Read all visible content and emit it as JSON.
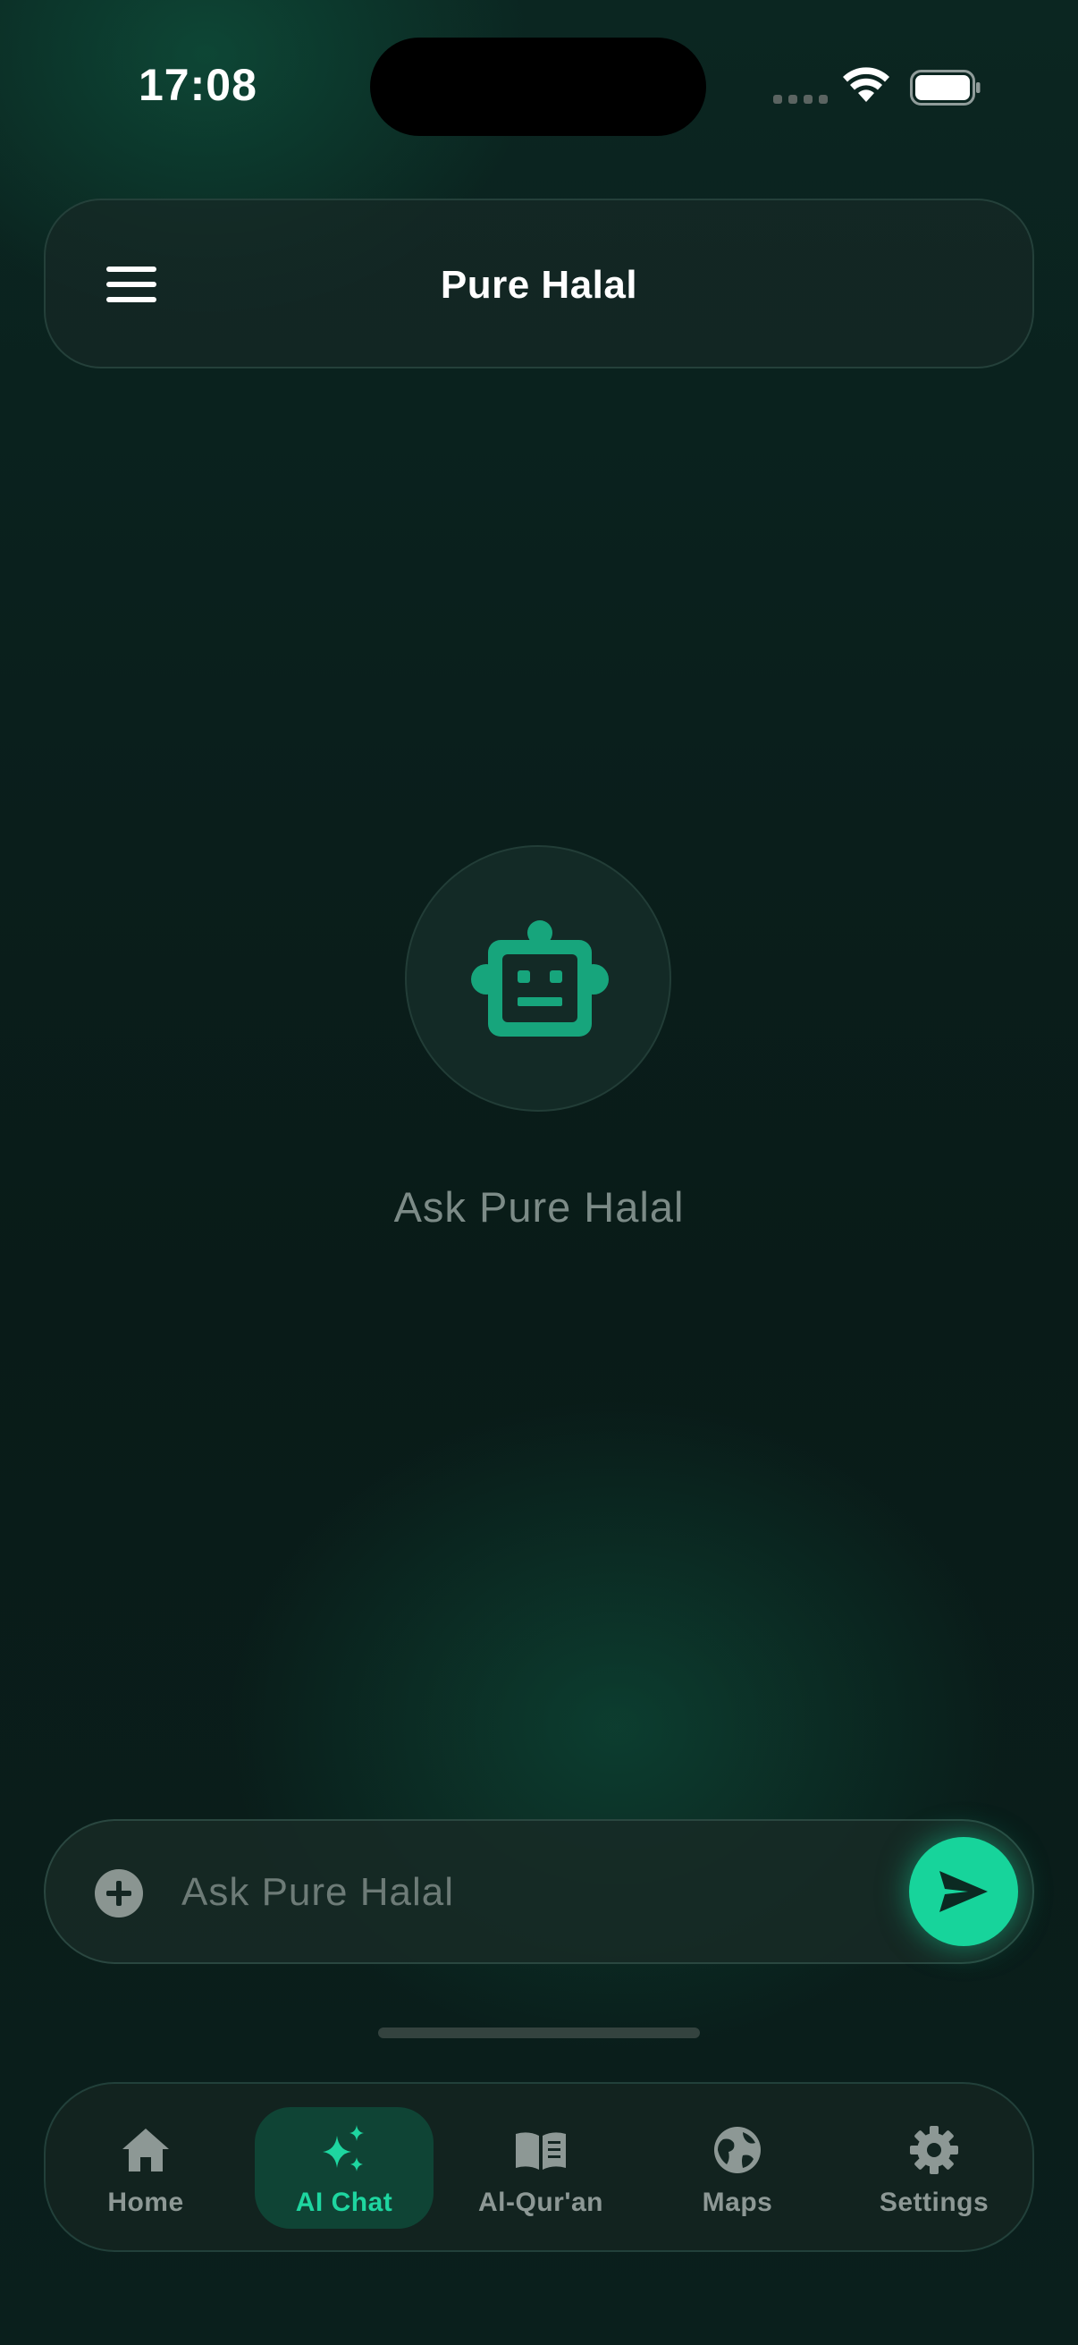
{
  "status_bar": {
    "time": "17:08"
  },
  "header": {
    "title": "Pure Halal",
    "menu_icon": "hamburger-menu-icon"
  },
  "empty_state": {
    "icon": "robot-icon",
    "prompt": "Ask Pure Halal"
  },
  "composer": {
    "placeholder": "Ask Pure Halal",
    "value": "",
    "add_icon": "plus-circle-icon",
    "send_icon": "send-icon"
  },
  "tab_bar": {
    "active": "AI Chat",
    "items": [
      {
        "label": "Home",
        "icon": "home-icon"
      },
      {
        "label": "AI Chat",
        "icon": "sparkles-icon"
      },
      {
        "label": "Al-Qur'an",
        "icon": "book-open-icon"
      },
      {
        "label": "Maps",
        "icon": "globe-icon"
      },
      {
        "label": "Settings",
        "icon": "gear-icon"
      }
    ]
  },
  "colors": {
    "accent": "#17d49b",
    "active_tab_bg": "#0f4435",
    "background": "#0a1f1c",
    "muted_text": "#7c8b87"
  }
}
